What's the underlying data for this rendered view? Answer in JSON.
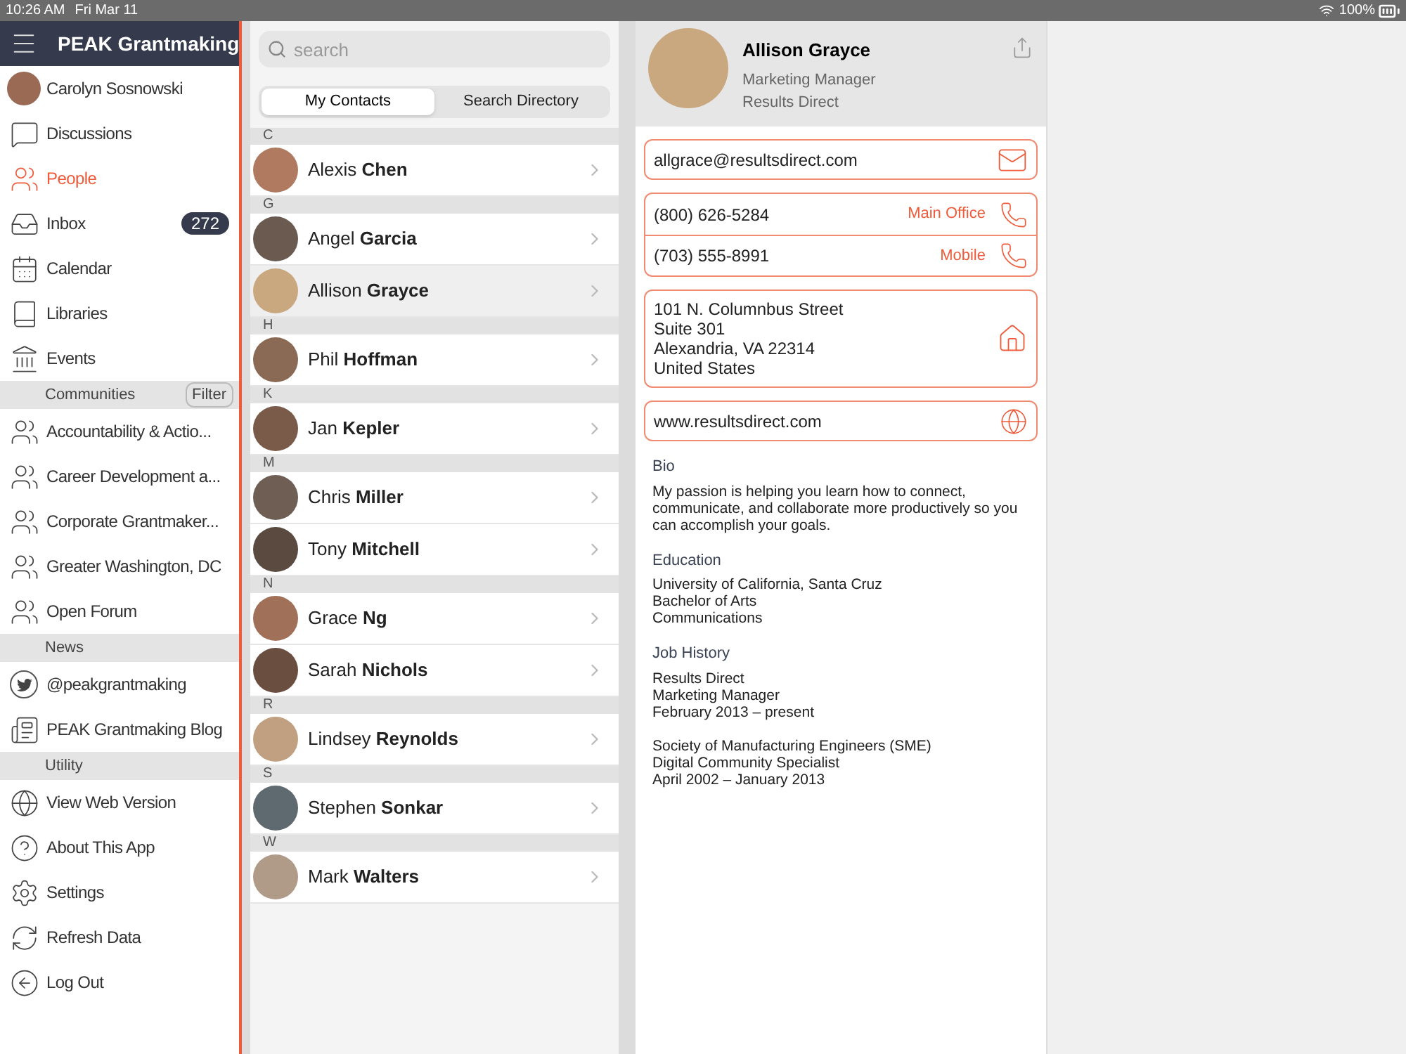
{
  "status_bar": {
    "time": "10:26 AM",
    "date": "Fri Mar 11",
    "battery": "100%"
  },
  "sidebar": {
    "title": "PEAK Grantmaking",
    "items": [
      {
        "label": "Carolyn Sosnowski",
        "selected": false
      },
      {
        "label": "Discussions",
        "selected": false
      },
      {
        "label": "People",
        "selected": true
      },
      {
        "label": "Inbox",
        "selected": false,
        "badge": "272"
      },
      {
        "label": "Calendar",
        "selected": false
      },
      {
        "label": "Libraries",
        "selected": false
      },
      {
        "label": "Events",
        "selected": false
      }
    ],
    "sections": [
      {
        "title": "Communities",
        "filter_button": "Filter",
        "items": [
          {
            "label": "Accountability & Actio...",
            "selected": false
          },
          {
            "label": "Career Development a...",
            "selected": false
          },
          {
            "label": "Corporate Grantmaker...",
            "selected": false
          },
          {
            "label": "Greater Washington, DC",
            "selected": false
          },
          {
            "label": "Open Forum",
            "selected": false
          }
        ]
      },
      {
        "title": "News",
        "items": [
          {
            "label": "@peakgrantmaking",
            "selected": false
          },
          {
            "label": "PEAK Grantmaking Blog",
            "selected": false
          }
        ]
      },
      {
        "title": "Utility",
        "items": [
          {
            "label": "View Web Version",
            "selected": false
          },
          {
            "label": "About This App",
            "selected": false
          },
          {
            "label": "Settings",
            "selected": false
          },
          {
            "label": "Refresh Data",
            "selected": false
          },
          {
            "label": "Log Out",
            "selected": false
          }
        ]
      }
    ]
  },
  "contacts": {
    "search": {
      "placeholder": "search"
    },
    "tabs": [
      {
        "label": "My Contacts",
        "selected": true
      },
      {
        "label": "Search Directory",
        "selected": false
      }
    ],
    "sections": [
      {
        "letter": "C",
        "contacts": [
          {
            "name": "Alexis **Chen**",
            "selected": false
          }
        ]
      },
      {
        "letter": "G",
        "contacts": [
          {
            "name": "Angel **Garcia**",
            "selected": false
          },
          {
            "name": "Allison **Grayce**",
            "selected": true
          }
        ]
      },
      {
        "letter": "H",
        "contacts": [
          {
            "name": "Phil **Hoffman**",
            "selected": false
          }
        ]
      },
      {
        "letter": "K",
        "contacts": [
          {
            "name": "Jan **Kepler**",
            "selected": false
          }
        ]
      },
      {
        "letter": "M",
        "contacts": [
          {
            "name": "Chris **Miller**",
            "selected": false
          },
          {
            "name": "Tony **Mitchell**",
            "selected": false
          }
        ]
      },
      {
        "letter": "N",
        "contacts": [
          {
            "name": "Grace **Ng**",
            "selected": false
          },
          {
            "name": "Sarah **Nichols**",
            "selected": false
          }
        ]
      },
      {
        "letter": "R",
        "contacts": [
          {
            "name": "Lindsey **Reynolds**",
            "selected": false
          }
        ]
      },
      {
        "letter": "S",
        "contacts": [
          {
            "name": "Stephen **Sonkar**",
            "selected": false
          }
        ]
      },
      {
        "letter": "W",
        "contacts": [
          {
            "name": "Mark **Walters**",
            "selected": false
          }
        ]
      }
    ]
  },
  "detail": {
    "name": "Allison Grayce",
    "title": "Marketing Manager",
    "company": "Results Direct",
    "email": "allgrace@resultsdirect.com",
    "phones": [
      {
        "number": "(800) 626-5284",
        "label": "Main Office"
      },
      {
        "number": "(703) 555-8991",
        "label": "Mobile"
      }
    ],
    "address": [
      "101 N. Columnbus Street",
      "Suite 301",
      "Alexandria, VA 22314",
      "United States"
    ],
    "website": "www.resultsdirect.com",
    "sections": [
      {
        "heading": "Bio",
        "blocks": [
          [
            "My passion is helping you learn how to connect, communicate, and collaborate more productively so you can accomplish your goals."
          ]
        ]
      },
      {
        "heading": "Education",
        "blocks": [
          [
            "University of California, Santa Cruz",
            "Bachelor of Arts",
            "Communications"
          ]
        ]
      },
      {
        "heading": "Job History",
        "blocks": [
          [
            "Results Direct",
            "Marketing Manager",
            "February 2013 – present"
          ],
          [
            "Society of Manufacturing Engineers (SME)",
            "Digital Community Specialist",
            "April 2002 – January 2013"
          ]
        ]
      }
    ]
  }
}
